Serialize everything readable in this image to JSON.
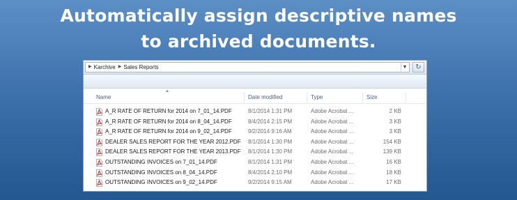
{
  "headline": {
    "line1": "Automatically assign descriptive names",
    "line2": "to archived documents."
  },
  "address": {
    "segments": [
      "Karchive",
      "Sales Reports"
    ],
    "refresh_icon": "refresh-icon",
    "dropdown_icon": "chevron-down-icon"
  },
  "columns": {
    "name": "Name",
    "date": "Date modified",
    "type": "Type",
    "size": "Size"
  },
  "files": [
    {
      "name": "A_R RATE OF RETURN for 2014 on  7_01_14.PDF",
      "date": "8/1/2014 1:31 PM",
      "type": "Adobe Acrobat ...",
      "size": "2 KB"
    },
    {
      "name": "A_R RATE OF RETURN for 2014 on  8_04_14.PDF",
      "date": "8/4/2014 2:15 PM",
      "type": "Adobe Acrobat ...",
      "size": "3 KB"
    },
    {
      "name": "A_R RATE OF RETURN for 2014 on  9_02_14.PDF",
      "date": "9/2/2014 9:16 AM",
      "type": "Adobe Acrobat ...",
      "size": "3 KB"
    },
    {
      "name": "DEALER SALES REPORT FOR THE YEAR 2012.PDF",
      "date": "8/1/2014 1:30 PM",
      "type": "Adobe Acrobat ...",
      "size": "154 KB"
    },
    {
      "name": "DEALER SALES REPORT FOR THE YEAR 2013.PDF",
      "date": "8/1/2014 1:30 PM",
      "type": "Adobe Acrobat ...",
      "size": "139 KB"
    },
    {
      "name": "OUTSTANDING INVOICES on  7_01_14.PDF",
      "date": "8/1/2014 1:31 PM",
      "type": "Adobe Acrobat ...",
      "size": "16 KB"
    },
    {
      "name": "OUTSTANDING INVOICES on  8_04_14.PDF",
      "date": "8/4/2014 2:10 PM",
      "type": "Adobe Acrobat ...",
      "size": "18 KB"
    },
    {
      "name": "OUTSTANDING INVOICES on  9_02_14.PDF",
      "date": "9/2/2014 9:15 AM",
      "type": "Adobe Acrobat ...",
      "size": "17 KB"
    }
  ],
  "file_icon": "pdf-file-icon",
  "colors": {
    "background_top": "#5c8fc6",
    "background_bottom": "#23578f",
    "pdf_red": "#c8211b"
  }
}
